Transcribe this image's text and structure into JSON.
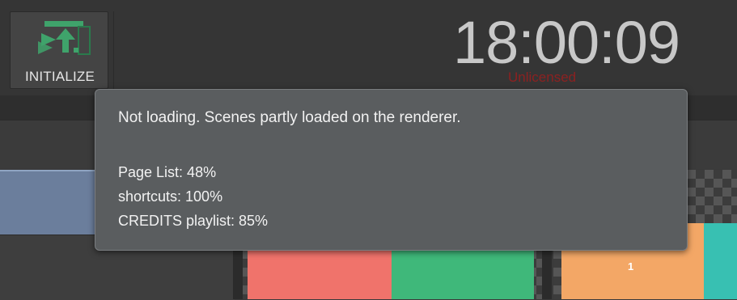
{
  "toolbar": {
    "initialize_label": "INITIALIZE",
    "initialize_icon": "initialize-icon",
    "accent_color": "#3fa36b"
  },
  "clock": {
    "time": "18:00:09",
    "license_status": "Unlicensed",
    "license_color": "#8c2121"
  },
  "tooltip": {
    "title": "Not loading. Scenes partly loaded on the renderer.",
    "items": [
      "Page List: 48%",
      "shortcuts: 100%",
      "CREDITS playlist: 85%"
    ]
  },
  "thumbnails": {
    "second_number": "1"
  }
}
